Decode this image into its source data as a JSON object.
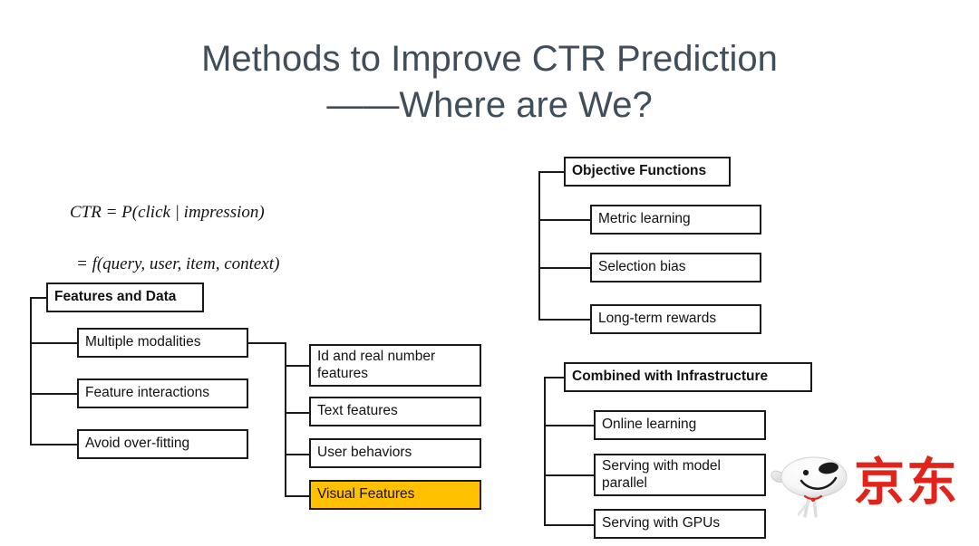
{
  "slide": {
    "background_color": "#FFFFFF",
    "title": {
      "line1": "Methods to Improve CTR Prediction",
      "line2": "——Where are We?",
      "color": "#404E5C"
    },
    "formula": {
      "line1": "CTR = P(click | impression)",
      "line2": "= f(query, user, item, context)"
    }
  },
  "trees": {
    "features_and_data": {
      "root": "Features and Data",
      "children": [
        "Multiple modalities",
        "Feature interactions",
        "Avoid over-fitting"
      ],
      "modality_children": [
        "Id and real number features",
        "Text features",
        "User behaviors",
        "Visual Features"
      ],
      "highlighted_child": "Visual Features",
      "highlight_color": "#FFC000"
    },
    "objective_functions": {
      "root": "Objective Functions",
      "children": [
        "Metric learning",
        "Selection bias",
        "Long-term rewards"
      ]
    },
    "combined_with_infrastructure": {
      "root": "Combined with Infrastructure",
      "children": [
        "Online learning",
        "Serving with model parallel",
        "Serving with GPUs"
      ]
    }
  },
  "branding": {
    "logo_text": "京东",
    "logo_color": "#E2231A",
    "mascot": "jd-joy-dog-icon"
  }
}
